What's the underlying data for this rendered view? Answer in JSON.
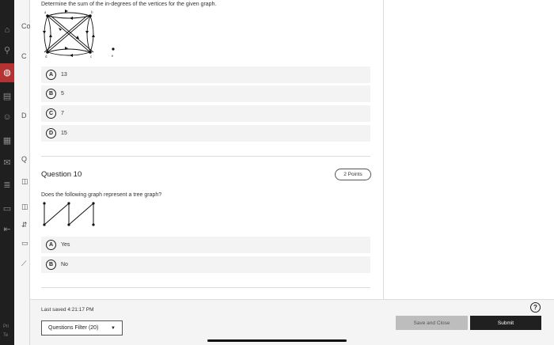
{
  "sidebar": {
    "icons": [
      "home-icon",
      "search-icon",
      "globe-icon",
      "book-icon",
      "people-icon",
      "calendar-icon",
      "mail-icon",
      "notes-icon",
      "box-icon",
      "logout-icon"
    ],
    "footer_lines": [
      "Pri",
      "Te"
    ]
  },
  "course_panel": {
    "glyphs": [
      "Co",
      "C",
      "D",
      "Q",
      "◫",
      "◫",
      "⇵",
      "▭",
      "⟋"
    ]
  },
  "question9": {
    "prompt": "Determine the sum of the in-degrees of the vertices for the given graph.",
    "vertex_labels": [
      "a",
      "b",
      "d",
      "c",
      "e"
    ],
    "options": [
      {
        "letter": "A",
        "text": "13"
      },
      {
        "letter": "B",
        "text": "5"
      },
      {
        "letter": "C",
        "text": "7"
      },
      {
        "letter": "D",
        "text": "15"
      }
    ]
  },
  "question10": {
    "title": "Question 10",
    "points": "2 Points",
    "prompt": "Does the following graph represent a tree graph?",
    "options": [
      {
        "letter": "A",
        "text": "Yes"
      },
      {
        "letter": "B",
        "text": "No"
      }
    ]
  },
  "footer": {
    "last_saved": "Last saved 4:21:17 PM",
    "filter_label": "Questions Filter (20)",
    "help_glyph": "?",
    "save_close_label": "Save and Close",
    "submit_label": "Submit"
  }
}
